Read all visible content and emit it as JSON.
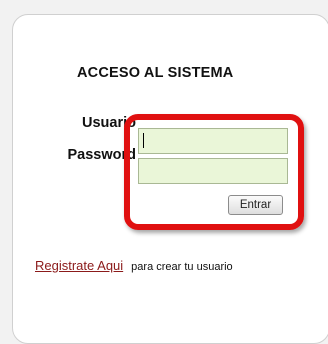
{
  "login": {
    "title": "ACCESO AL SISTEMA",
    "username_label": "Usuario",
    "password_label": "Password",
    "username_value": "",
    "password_value": "",
    "submit_label": "Entrar"
  },
  "register": {
    "link_text": "Registrate Aqui",
    "note": "para crear tu usuario"
  },
  "colors": {
    "highlight": "#e01010",
    "input_bg": "#eaf6d8",
    "link": "#8b1a1a"
  }
}
